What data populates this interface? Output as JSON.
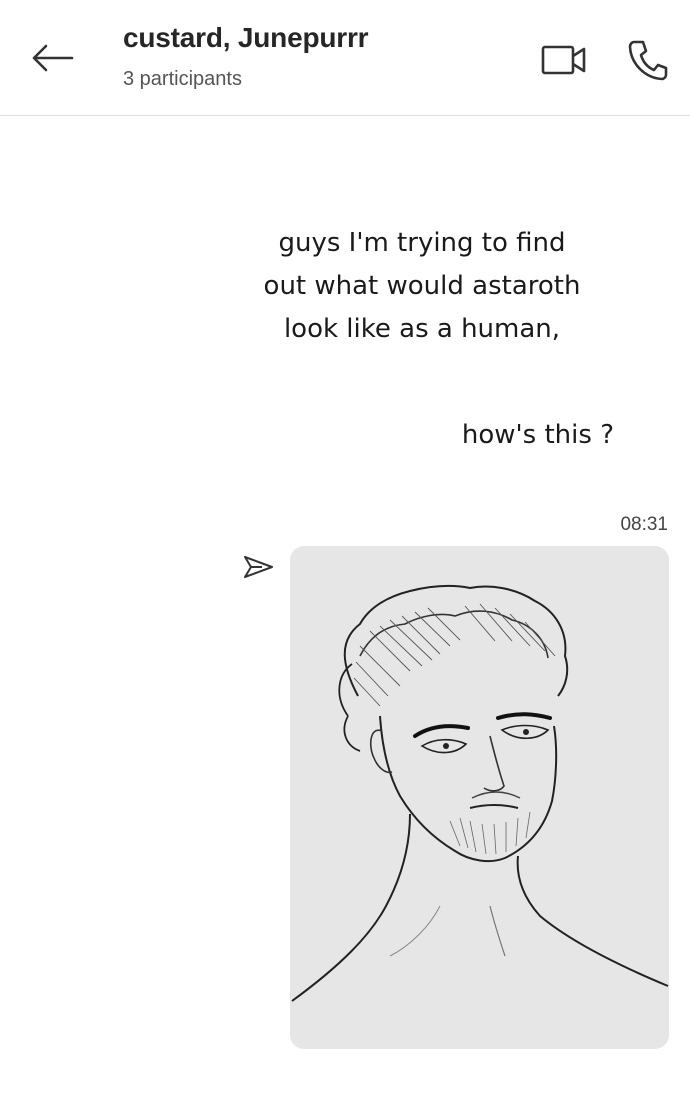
{
  "header": {
    "title": "custard, Junepurrr",
    "subtitle": "3 participants",
    "icons": {
      "back": "arrow-left-icon",
      "video": "video-camera-icon",
      "call": "phone-icon"
    }
  },
  "messages": [
    {
      "type": "text",
      "text": "guys I'm trying to find\nout what would astaroth\nlook like as a human,"
    },
    {
      "type": "text",
      "text": "how's this ?"
    },
    {
      "type": "image",
      "timestamp": "08:31",
      "status_icon": "sent-paper-plane-icon",
      "image_description_icon": "sketch-portrait-image"
    }
  ],
  "colors": {
    "image_bubble_bg": "#e6e6e6",
    "divider": "#dcdcdc",
    "text": "#1a1a1a"
  }
}
